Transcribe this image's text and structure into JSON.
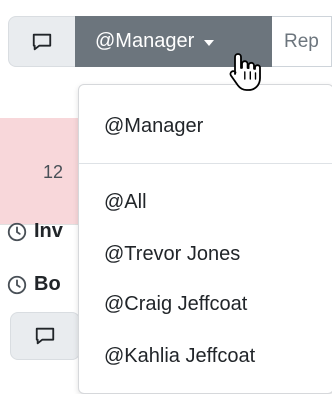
{
  "toolbar": {
    "chat_icon": "speech-bubble-icon",
    "mention_label": "@Manager",
    "reply_placeholder": "Rep"
  },
  "background_rows": {
    "count_text": "12",
    "clock_icon": "clock-icon",
    "items": [
      {
        "label": "Inv"
      },
      {
        "label": "Bo"
      }
    ]
  },
  "mention_menu": {
    "selected": "@Manager",
    "options": [
      {
        "label": "@All"
      },
      {
        "label": "@Trevor Jones"
      },
      {
        "label": "@Craig Jeffcoat"
      },
      {
        "label": "@Kahlia Jeffcoat"
      }
    ]
  },
  "colors": {
    "mention_button_bg": "#6c757d",
    "chat_button_bg": "#e9ecef",
    "alert_row_bg": "#f8d7da"
  }
}
